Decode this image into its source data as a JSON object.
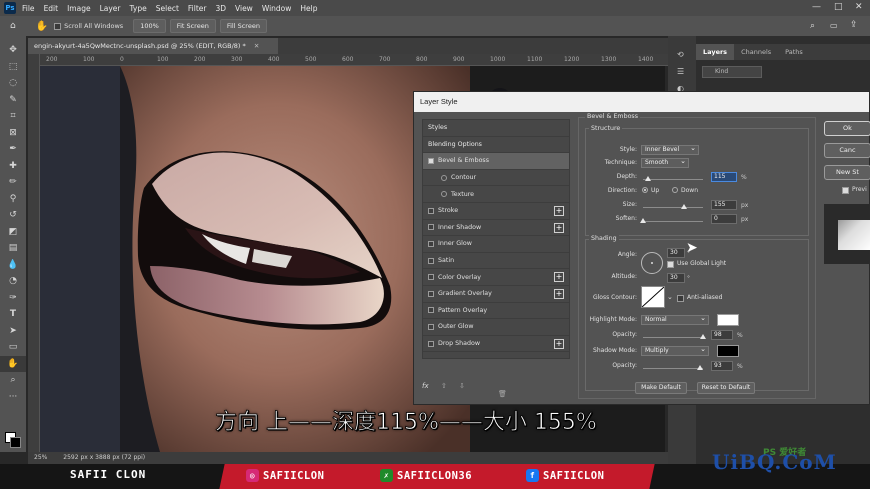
{
  "app": {
    "logo": "Ps",
    "menu": [
      "File",
      "Edit",
      "Image",
      "Layer",
      "Type",
      "Select",
      "Filter",
      "3D",
      "View",
      "Window",
      "Help"
    ]
  },
  "options_bar": {
    "scroll_all_windows": "Scroll All Windows",
    "zoom": "100%",
    "fit_screen": "Fit Screen",
    "fill_screen": "Fill Screen"
  },
  "document": {
    "tab_title": "engin-akyurt-4a5QwMectnc-unsplash.psd @ 25% (EDIT, RGB/8) *",
    "zoom_status": "25%",
    "doc_info": "2592 px x 3888 px (72 ppi)",
    "ruler_ticks": [
      "200",
      "100",
      "0",
      "100",
      "200",
      "300",
      "400",
      "500",
      "600",
      "700",
      "800",
      "900",
      "1000",
      "1100",
      "1200",
      "1300",
      "1400"
    ]
  },
  "layers_panel": {
    "tabs": [
      "Layers",
      "Channels",
      "Paths"
    ],
    "kind_placeholder": "Kind"
  },
  "layer_style": {
    "title": "Layer Style",
    "list": {
      "styles": "Styles",
      "blending_options": "Blending Options",
      "items": [
        {
          "label": "Bevel & Emboss",
          "checked": true,
          "active": true,
          "sub": false,
          "plus": false
        },
        {
          "label": "Contour",
          "checked": false,
          "active": false,
          "sub": true,
          "plus": false
        },
        {
          "label": "Texture",
          "checked": false,
          "active": false,
          "sub": true,
          "plus": false
        },
        {
          "label": "Stroke",
          "checked": false,
          "active": false,
          "sub": false,
          "plus": true
        },
        {
          "label": "Inner Shadow",
          "checked": false,
          "active": false,
          "sub": false,
          "plus": true
        },
        {
          "label": "Inner Glow",
          "checked": false,
          "active": false,
          "sub": false,
          "plus": false
        },
        {
          "label": "Satin",
          "checked": false,
          "active": false,
          "sub": false,
          "plus": false
        },
        {
          "label": "Color Overlay",
          "checked": false,
          "active": false,
          "sub": false,
          "plus": true
        },
        {
          "label": "Gradient Overlay",
          "checked": false,
          "active": false,
          "sub": false,
          "plus": true
        },
        {
          "label": "Pattern Overlay",
          "checked": false,
          "active": false,
          "sub": false,
          "plus": false
        },
        {
          "label": "Outer Glow",
          "checked": false,
          "active": false,
          "sub": false,
          "plus": false
        },
        {
          "label": "Drop Shadow",
          "checked": false,
          "active": false,
          "sub": false,
          "plus": true
        }
      ],
      "footer_fx": "fx"
    },
    "bevel": {
      "heading": "Bevel & Emboss",
      "structure_heading": "Structure",
      "style_label": "Style:",
      "style_value": "Inner Bevel",
      "technique_label": "Technique:",
      "technique_value": "Smooth",
      "depth_label": "Depth:",
      "depth_value": "115",
      "depth_unit": "%",
      "direction_label": "Direction:",
      "direction_up": "Up",
      "direction_down": "Down",
      "size_label": "Size:",
      "size_value": "155",
      "size_unit": "px",
      "soften_label": "Soften:",
      "soften_value": "0",
      "soften_unit": "px",
      "shading_heading": "Shading",
      "angle_label": "Angle:",
      "angle_value": "30",
      "angle_unit": "°",
      "global_light_label": "Use Global Light",
      "altitude_label": "Altitude:",
      "altitude_value": "30",
      "altitude_unit": "°",
      "gloss_contour_label": "Gloss Contour:",
      "anti_aliased_label": "Anti-aliased",
      "highlight_mode_label": "Highlight Mode:",
      "highlight_mode_value": "Normal",
      "highlight_color": "#ffffff",
      "highlight_opacity_label": "Opacity:",
      "highlight_opacity_value": "98",
      "shadow_mode_label": "Shadow Mode:",
      "shadow_mode_value": "Multiply",
      "shadow_color": "#000000",
      "shadow_opacity_label": "Opacity:",
      "shadow_opacity_value": "93",
      "percent": "%",
      "make_default": "Make Default",
      "reset_to_default": "Reset to Default"
    },
    "buttons": {
      "ok": "Ok",
      "cancel": "Canc",
      "new_style": "New St",
      "preview": "Previ"
    }
  },
  "subtitle": "方向 上——深度115%——大小 155%",
  "social_bar": {
    "brand": "SAFII CLON",
    "instagram": "SAFIICLON",
    "xsite": "SAFIICLON36",
    "facebook": "SAFIICLON"
  },
  "watermark": {
    "main": "UiBQ.CoM",
    "small": "PS 爱好者"
  }
}
